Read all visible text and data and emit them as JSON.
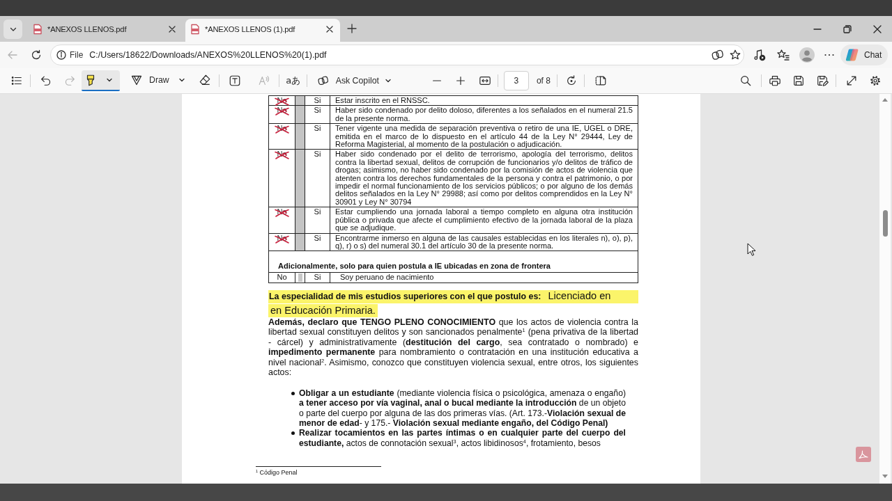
{
  "tabs": [
    {
      "title": "*ANEXOS LLENOS.pdf",
      "selected": false
    },
    {
      "title": "*ANEXOS LLENOS (1).pdf",
      "selected": true
    }
  ],
  "back": {
    "disabled": true
  },
  "address_bar": {
    "site_label": "File",
    "url": "C:/Users/18622/Downloads/ANEXOS%20LLENOS%20(1).pdf"
  },
  "chat_button": {
    "label": "Chat"
  },
  "pdf_toolbar": {
    "history": [
      {
        "kind": "undo",
        "disabled": false
      },
      {
        "kind": "redo",
        "disabled": true
      }
    ],
    "tools": [
      {
        "kind": "highlight",
        "selected": true
      },
      {
        "kind": "draw",
        "label": "Draw",
        "selected": false
      },
      {
        "kind": "erase",
        "selected": false
      }
    ],
    "read_aloud": {
      "disabled": true
    },
    "translate": {
      "glyph": "aあ"
    },
    "copilot": {
      "label": "Ask Copilot"
    },
    "page": {
      "value": "3",
      "total": "of 8"
    }
  },
  "document": {
    "table": {
      "rows": [
        {
          "answer": "No",
          "crossed_out": true,
          "option": "Si",
          "text": "Estar inscrito en el RNSSC."
        },
        {
          "answer": "No",
          "crossed_out": true,
          "option": "Si",
          "text": "Haber sido condenado por delito doloso, diferentes a los señalados en el numeral 21.5 de la presente norma."
        },
        {
          "answer": "No",
          "crossed_out": true,
          "option": "Si",
          "text": "Tener vigente una medida de separación preventiva o retiro de una IE, UGEL o DRE, emitida en el marco de lo dispuesto en el artículo 44 de la Ley N° 29444, Ley de Reforma Magisterial, al momento de la postulación o adjudicación."
        },
        {
          "answer": "No",
          "crossed_out": true,
          "option": "Si",
          "text": "Haber sido condenado por el delito de terrorismo, apología del terrorismo, delitos contra la libertad sexual, delitos de corrupción de funcionarios y/o delitos de tráfico de drogas; asimismo, no haber sido condenado por la comisión de actos de violencia que atenten contra los derechos fundamentales de la persona y contra el patrimonio, o por impedir el normal funcionamiento de los servicios públicos; o por alguno de los demás delitos señalados en la Ley N° 29988; así como por delitos comprendidos en la Ley N° 30901 y Ley N° 30794"
        },
        {
          "answer": "No",
          "crossed_out": true,
          "option": "Si",
          "text": "Estar cumpliendo una jornada laboral a tiempo completo en alguna otra institución pública o privada que afecte el cumplimiento efectivo de la jornada laboral de la plaza que se adjudique."
        },
        {
          "answer": "No",
          "crossed_out": true,
          "option": "Si",
          "text": "Encontrarme inmerso en alguna de las causales establecidas en los literales n), o), p), q), r) o s) del numeral 30.1 del artículo 30 de la presente norma."
        }
      ]
    },
    "frontier": {
      "heading": "Adicionalmente, solo para quien postula a IE ubicadas en zona de frontera",
      "row": {
        "answer": "No",
        "crossed_out": false,
        "option": "Si",
        "text": "Soy peruano de nacimiento"
      }
    },
    "specialty": {
      "label": "La especialidad de mis estudios superiores con el que postulo es:",
      "value_lines": [
        "Licenciado en",
        "en Educación Primaria."
      ]
    },
    "declaration": "**Además, declaro que TENGO PLENO CONOCIMIENTO** que los actos de violencia contra la libertad sexual constituyen delitos y son sancionados penalmente$^{1}$  (pena privativa de la libertad - cárcel) y administrativamente (**destitución del cargo**, sea contratado o nombrado) e **impedimento permanente** para nombramiento o contratación en una institución educativa a nivel nacional$^{2}$. Asimismo, conozco que constituyen violencia sexual, entre otros, los siguientes actos:",
    "bullets": [
      "**Obligar a un estudiante** (mediante violencia física o psicológica, amenaza o engaño) **a tener acceso por vía vaginal, anal o bucal mediante la introducción** de un objeto o parte del cuerpo por alguna de las dos primeras vías. (Art. 173.-**Violación sexual de menor de edad**- y 175.- **Violación sexual mediante engaño, del Código Penal)**",
      "**Realizar tocamientos en las partes íntimas o en cualquier parte del cuerpo del estudiante,** actos de connotación sexual$^{3}$, actos libidinosos$^{4}$, frotamiento, besos"
    ],
    "footnote": "$^{1}$ Código Penal"
  }
}
